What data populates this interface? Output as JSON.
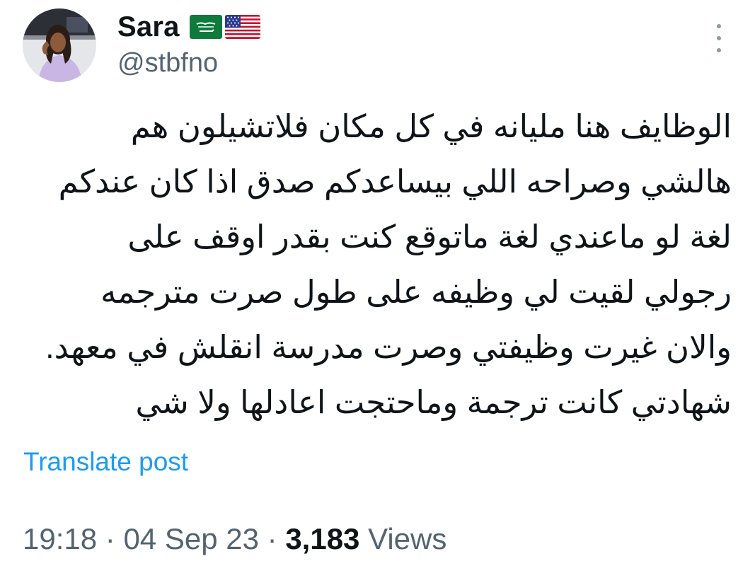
{
  "author": {
    "name": "Sara",
    "handle": "@stbfno",
    "flags": [
      "saudi-arabia-flag-icon",
      "usa-flag-icon"
    ]
  },
  "tweet": {
    "text": "الوظايف هنا مليانه في كل مكان فلاتشيلون هم\nهالشي وصراحه اللي بيساعدكم صدق اذا كان عندكم\nلغة لو ماعندي لغة ماتوقع كنت بقدر اوقف على\nرجولي لقيت لي وظيفه على طول صرت مترجمه\nوالان غيرت وظيفتي وصرت مدرسة انقلش في معهد.\nشهادتي كانت ترجمة وماحتجت اعادلها ولا شي",
    "translate_label": "Translate post"
  },
  "meta": {
    "time": "19:18",
    "date": "04 Sep 23",
    "separator": "·",
    "views_count": "3,183",
    "views_label": "Views"
  },
  "colors": {
    "text": "#0f1419",
    "secondary": "#536471",
    "link": "#1d9bf0"
  }
}
